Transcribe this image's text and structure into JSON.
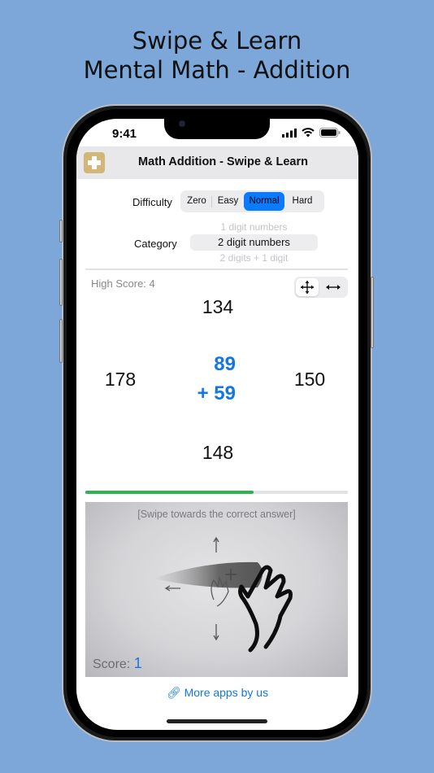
{
  "promo": {
    "line1": "Swipe & Learn",
    "line2": "Mental Math - Addition"
  },
  "status_bar": {
    "time": "9:41",
    "icons": [
      "signal-icon",
      "wifi-icon",
      "battery-icon"
    ]
  },
  "navbar": {
    "app_icon": "plus-icon",
    "title": "Math Addition - Swipe & Learn",
    "app_icon_color": "#d4b778"
  },
  "settings": {
    "difficulty_label": "Difficulty",
    "difficulty_options": [
      "Zero",
      "Easy",
      "Normal",
      "Hard"
    ],
    "difficulty_selected": "Normal",
    "category_label": "Category",
    "category_options": [
      "1 digit numbers",
      "2 digit numbers",
      "2 digits + 1 digit"
    ],
    "category_selected": "2 digit numbers"
  },
  "game": {
    "high_score_text": "High Score: 4",
    "mode_options": [
      "four-direction-move-icon",
      "horizontal-arrows-icon"
    ],
    "mode_selected": "four-direction-move-icon",
    "answers": {
      "top": "134",
      "left": "178",
      "right": "150",
      "bottom": "148"
    },
    "question": {
      "operand1": "89",
      "operand2": "+ 59"
    },
    "progress": 0.64,
    "accent_color": "#1477e0",
    "progress_color": "#2fb350"
  },
  "gesture_area": {
    "hint": "[Swipe towards the correct answer]",
    "score_label": "Score:",
    "score_value": "1"
  },
  "footer": {
    "more_apps": "More apps by us",
    "link_icon": "link-icon"
  }
}
